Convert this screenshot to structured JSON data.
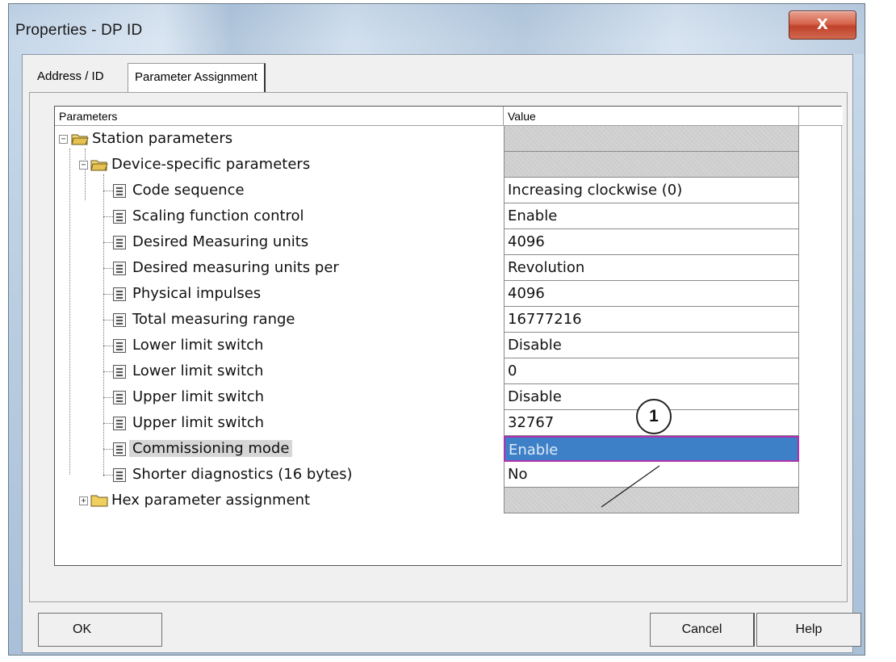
{
  "window": {
    "title": "Properties - DP ID",
    "close_glyph": "X"
  },
  "tabs": [
    {
      "label": "Address / ID"
    },
    {
      "label": "Parameter Assignment"
    }
  ],
  "grid": {
    "headers": {
      "parameters": "Parameters",
      "value": "Value"
    },
    "rows": [
      {
        "label": "Station parameters",
        "value": ""
      },
      {
        "label": "Device-specific parameters",
        "value": ""
      },
      {
        "label": "Code sequence",
        "value": "Increasing clockwise (0)"
      },
      {
        "label": "Scaling function control",
        "value": "Enable"
      },
      {
        "label": "Desired Measuring units",
        "value": "4096"
      },
      {
        "label": "Desired measuring units per",
        "value": "Revolution"
      },
      {
        "label": "Physical impulses",
        "value": "4096"
      },
      {
        "label": "Total measuring range",
        "value": "16777216"
      },
      {
        "label": "Lower limit switch",
        "value": "Disable"
      },
      {
        "label": "Lower limit switch",
        "value": "0"
      },
      {
        "label": "Upper limit switch",
        "value": "Disable"
      },
      {
        "label": "Upper limit switch",
        "value": "32767"
      },
      {
        "label": "Commissioning mode",
        "value": "Enable"
      },
      {
        "label": "Shorter diagnostics (16 bytes)",
        "value": "No"
      },
      {
        "label": "Hex parameter assignment",
        "value": ""
      }
    ]
  },
  "callout": {
    "number": "1"
  },
  "buttons": {
    "ok": "OK",
    "cancel": "Cancel",
    "help": "Help"
  },
  "colors": {
    "selection": "#3d80c8",
    "selection_border": "#b030b0",
    "close_button": "#c7452d",
    "folder": "#e8c65a"
  },
  "icons": {
    "folder": "folder-icon",
    "open_folder": "folder-open-icon",
    "parameter": "parameter-icon"
  }
}
